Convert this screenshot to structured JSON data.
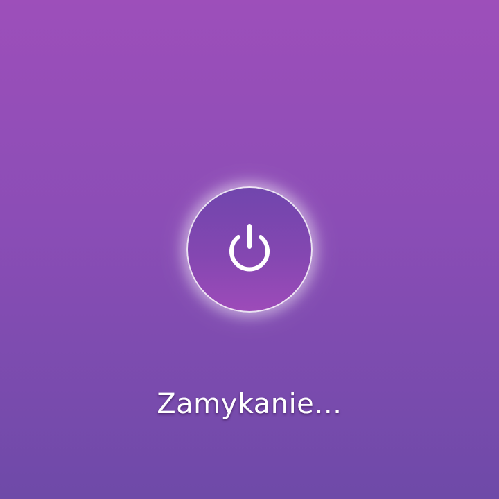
{
  "shutdown": {
    "status_text": "Zamykanie…",
    "icon": "power-icon"
  },
  "colors": {
    "background_top": "#9d4fba",
    "background_bottom": "#6e4aa8",
    "circle_top": "#7146ad",
    "circle_bottom": "#9d4bb9",
    "text": "#ffffff"
  }
}
